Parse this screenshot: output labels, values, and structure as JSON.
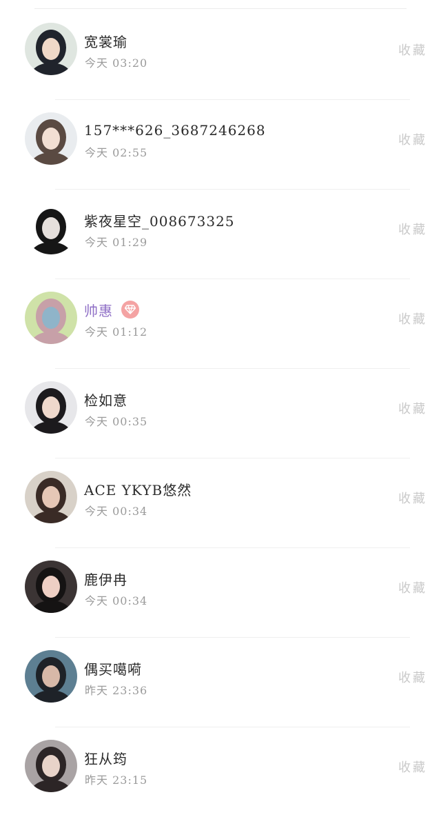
{
  "contacts": [
    {
      "name": "宽裳瑜",
      "time": "今天 03:20",
      "favorite_label": "收藏",
      "vip": false,
      "avatar_colors": [
        "#dfe6e0",
        "#20242c",
        "#f0d9c8"
      ]
    },
    {
      "name": "157***626_3687246268",
      "time": "今天 02:55",
      "favorite_label": "收藏",
      "vip": false,
      "avatar_colors": [
        "#e9ecef",
        "#5a4a42",
        "#f2dfd3"
      ]
    },
    {
      "name": "紫夜星空_008673325",
      "time": "今天 01:29",
      "favorite_label": "收藏",
      "vip": false,
      "avatar_colors": [
        "#ffffff",
        "#161616",
        "#e6e0dc"
      ]
    },
    {
      "name": "帅惠",
      "time": "今天 01:12",
      "favorite_label": "收藏",
      "vip": true,
      "avatar_colors": [
        "#cfe2a8",
        "#c7a0a8",
        "#8fb4c9"
      ]
    },
    {
      "name": "检如意",
      "time": "今天 00:35",
      "favorite_label": "收藏",
      "vip": false,
      "avatar_colors": [
        "#e7e7ea",
        "#1c1a1d",
        "#efd8cc"
      ]
    },
    {
      "name": "ACE YKYB悠然",
      "time": "今天 00:34",
      "favorite_label": "收藏",
      "vip": false,
      "avatar_colors": [
        "#d8d1c8",
        "#3a2b26",
        "#e6c7b6"
      ]
    },
    {
      "name": "鹿伊冉",
      "time": "今天 00:34",
      "favorite_label": "收藏",
      "vip": false,
      "avatar_colors": [
        "#3b3434",
        "#151313",
        "#eecfc4"
      ]
    },
    {
      "name": "偶买噶嗬",
      "time": "昨天 23:36",
      "favorite_label": "收藏",
      "vip": false,
      "avatar_colors": [
        "#5d7f92",
        "#1e2228",
        "#d7b8a8"
      ]
    },
    {
      "name": "狂从筠",
      "time": "昨天 23:15",
      "favorite_label": "收藏",
      "vip": false,
      "avatar_colors": [
        "#a9a3a4",
        "#2c2526",
        "#e8d3c9"
      ]
    }
  ],
  "icons": {
    "vip_badge": "diamond-icon"
  },
  "colors": {
    "name": "#2a2a2a",
    "vip_name": "#8f6fc6",
    "time": "#9a9a9a",
    "favorite": "#c9c9c9",
    "vip_badge": "#f4a3a3"
  }
}
